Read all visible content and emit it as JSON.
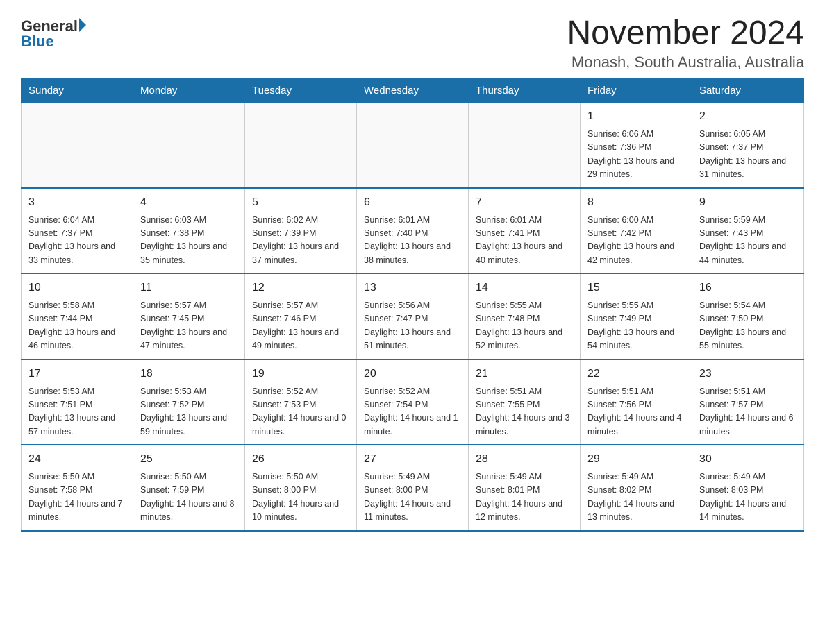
{
  "logo": {
    "general": "General",
    "blue": "Blue"
  },
  "header": {
    "month_year": "November 2024",
    "location": "Monash, South Australia, Australia"
  },
  "weekdays": [
    "Sunday",
    "Monday",
    "Tuesday",
    "Wednesday",
    "Thursday",
    "Friday",
    "Saturday"
  ],
  "weeks": [
    {
      "days": [
        {
          "number": "",
          "info": ""
        },
        {
          "number": "",
          "info": ""
        },
        {
          "number": "",
          "info": ""
        },
        {
          "number": "",
          "info": ""
        },
        {
          "number": "",
          "info": ""
        },
        {
          "number": "1",
          "info": "Sunrise: 6:06 AM\nSunset: 7:36 PM\nDaylight: 13 hours and 29 minutes."
        },
        {
          "number": "2",
          "info": "Sunrise: 6:05 AM\nSunset: 7:37 PM\nDaylight: 13 hours and 31 minutes."
        }
      ]
    },
    {
      "days": [
        {
          "number": "3",
          "info": "Sunrise: 6:04 AM\nSunset: 7:37 PM\nDaylight: 13 hours and 33 minutes."
        },
        {
          "number": "4",
          "info": "Sunrise: 6:03 AM\nSunset: 7:38 PM\nDaylight: 13 hours and 35 minutes."
        },
        {
          "number": "5",
          "info": "Sunrise: 6:02 AM\nSunset: 7:39 PM\nDaylight: 13 hours and 37 minutes."
        },
        {
          "number": "6",
          "info": "Sunrise: 6:01 AM\nSunset: 7:40 PM\nDaylight: 13 hours and 38 minutes."
        },
        {
          "number": "7",
          "info": "Sunrise: 6:01 AM\nSunset: 7:41 PM\nDaylight: 13 hours and 40 minutes."
        },
        {
          "number": "8",
          "info": "Sunrise: 6:00 AM\nSunset: 7:42 PM\nDaylight: 13 hours and 42 minutes."
        },
        {
          "number": "9",
          "info": "Sunrise: 5:59 AM\nSunset: 7:43 PM\nDaylight: 13 hours and 44 minutes."
        }
      ]
    },
    {
      "days": [
        {
          "number": "10",
          "info": "Sunrise: 5:58 AM\nSunset: 7:44 PM\nDaylight: 13 hours and 46 minutes."
        },
        {
          "number": "11",
          "info": "Sunrise: 5:57 AM\nSunset: 7:45 PM\nDaylight: 13 hours and 47 minutes."
        },
        {
          "number": "12",
          "info": "Sunrise: 5:57 AM\nSunset: 7:46 PM\nDaylight: 13 hours and 49 minutes."
        },
        {
          "number": "13",
          "info": "Sunrise: 5:56 AM\nSunset: 7:47 PM\nDaylight: 13 hours and 51 minutes."
        },
        {
          "number": "14",
          "info": "Sunrise: 5:55 AM\nSunset: 7:48 PM\nDaylight: 13 hours and 52 minutes."
        },
        {
          "number": "15",
          "info": "Sunrise: 5:55 AM\nSunset: 7:49 PM\nDaylight: 13 hours and 54 minutes."
        },
        {
          "number": "16",
          "info": "Sunrise: 5:54 AM\nSunset: 7:50 PM\nDaylight: 13 hours and 55 minutes."
        }
      ]
    },
    {
      "days": [
        {
          "number": "17",
          "info": "Sunrise: 5:53 AM\nSunset: 7:51 PM\nDaylight: 13 hours and 57 minutes."
        },
        {
          "number": "18",
          "info": "Sunrise: 5:53 AM\nSunset: 7:52 PM\nDaylight: 13 hours and 59 minutes."
        },
        {
          "number": "19",
          "info": "Sunrise: 5:52 AM\nSunset: 7:53 PM\nDaylight: 14 hours and 0 minutes."
        },
        {
          "number": "20",
          "info": "Sunrise: 5:52 AM\nSunset: 7:54 PM\nDaylight: 14 hours and 1 minute."
        },
        {
          "number": "21",
          "info": "Sunrise: 5:51 AM\nSunset: 7:55 PM\nDaylight: 14 hours and 3 minutes."
        },
        {
          "number": "22",
          "info": "Sunrise: 5:51 AM\nSunset: 7:56 PM\nDaylight: 14 hours and 4 minutes."
        },
        {
          "number": "23",
          "info": "Sunrise: 5:51 AM\nSunset: 7:57 PM\nDaylight: 14 hours and 6 minutes."
        }
      ]
    },
    {
      "days": [
        {
          "number": "24",
          "info": "Sunrise: 5:50 AM\nSunset: 7:58 PM\nDaylight: 14 hours and 7 minutes."
        },
        {
          "number": "25",
          "info": "Sunrise: 5:50 AM\nSunset: 7:59 PM\nDaylight: 14 hours and 8 minutes."
        },
        {
          "number": "26",
          "info": "Sunrise: 5:50 AM\nSunset: 8:00 PM\nDaylight: 14 hours and 10 minutes."
        },
        {
          "number": "27",
          "info": "Sunrise: 5:49 AM\nSunset: 8:00 PM\nDaylight: 14 hours and 11 minutes."
        },
        {
          "number": "28",
          "info": "Sunrise: 5:49 AM\nSunset: 8:01 PM\nDaylight: 14 hours and 12 minutes."
        },
        {
          "number": "29",
          "info": "Sunrise: 5:49 AM\nSunset: 8:02 PM\nDaylight: 14 hours and 13 minutes."
        },
        {
          "number": "30",
          "info": "Sunrise: 5:49 AM\nSunset: 8:03 PM\nDaylight: 14 hours and 14 minutes."
        }
      ]
    }
  ]
}
